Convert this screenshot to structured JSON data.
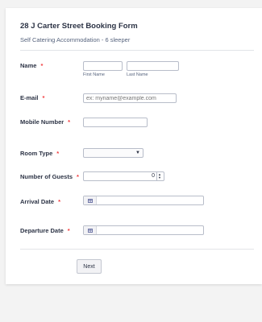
{
  "form": {
    "title": "28 J Carter Street Booking Form",
    "subtitle": "Self Catering Accommodation - 6 sleeper"
  },
  "fields": {
    "name": {
      "label": "Name",
      "required_mark": "*",
      "first_sublabel": "First Name",
      "last_sublabel": "Last Name"
    },
    "email": {
      "label": "E-mail",
      "required_mark": "*",
      "placeholder": "ex: myname@example.com"
    },
    "mobile": {
      "label": "Mobile Number",
      "required_mark": "*"
    },
    "room_type": {
      "label": "Room Type",
      "required_mark": "*",
      "selected": ""
    },
    "guests": {
      "label": "Number of Guests",
      "required_mark": "*",
      "value": "0"
    },
    "arrival": {
      "label": "Arrival Date",
      "required_mark": "*"
    },
    "departure": {
      "label": "Departure Date",
      "required_mark": "*"
    }
  },
  "icons": {
    "calendar": "calendar-icon",
    "dropdown": "chevron-down-icon"
  },
  "buttons": {
    "next_label": "Next"
  },
  "colors": {
    "required": "#f23a3c",
    "background": "#f3f3f3",
    "card": "#ffffff"
  }
}
